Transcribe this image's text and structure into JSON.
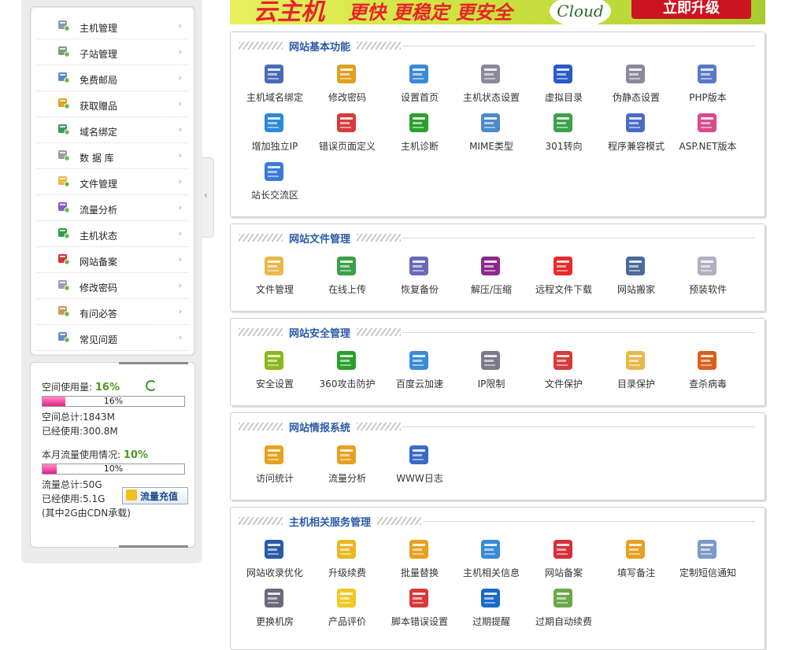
{
  "sidebar": {
    "items": [
      {
        "label": "主机管理",
        "icon": "server-icon",
        "color": "#8a9aa8"
      },
      {
        "label": "子站管理",
        "icon": "subsite-icon",
        "color": "#7aa07a"
      },
      {
        "label": "免费邮局",
        "icon": "mail-icon",
        "color": "#5a8ac8"
      },
      {
        "label": "获取赠品",
        "icon": "gift-icon",
        "color": "#e0a020"
      },
      {
        "label": "域名绑定",
        "icon": "globe-icon",
        "color": "#3a9a5a"
      },
      {
        "label": "数 据 库",
        "icon": "database-icon",
        "color": "#9a9aa8"
      },
      {
        "label": "文件管理",
        "icon": "folder-icon",
        "color": "#e8b84a"
      },
      {
        "label": "流量分析",
        "icon": "chart-icon",
        "color": "#8a5ac8"
      },
      {
        "label": "主机状态",
        "icon": "status-icon",
        "color": "#2aa04a"
      },
      {
        "label": "网站备案",
        "icon": "record-icon",
        "color": "#d8303a"
      },
      {
        "label": "修改密码",
        "icon": "password-icon",
        "color": "#9aa0b0"
      },
      {
        "label": "有问必答",
        "icon": "qa-icon",
        "color": "#c89a5a"
      },
      {
        "label": "常见问题",
        "icon": "faq-icon",
        "color": "#6a8ac8"
      }
    ]
  },
  "usage": {
    "space_label": "空间使用量:",
    "space_percent": "16%",
    "space_fraction": 0.16,
    "space_total": "空间总计:1843M",
    "space_used": "已经使用:300.8M",
    "traffic_label": "本月流量使用情况:",
    "traffic_percent": "10%",
    "traffic_fraction": 0.1,
    "traffic_total": "流量总计:50G",
    "traffic_used": "已经使用:5.1G",
    "cdn_note": "(其中2G由CDN承载)",
    "recharge_label": "流量充值"
  },
  "banner": {
    "title": "云主机",
    "slogan": "更快 更稳定 更安全",
    "cloud": "Cloud",
    "upgrade": "立即升级"
  },
  "sections": [
    {
      "title": "网站基本功能",
      "tools": [
        {
          "label": "主机域名绑定",
          "icon": "domain-bind-icon",
          "color": "#4a6ab8"
        },
        {
          "label": "修改密码",
          "icon": "lock-icon",
          "color": "#e0a020"
        },
        {
          "label": "设置首页",
          "icon": "homepage-icon",
          "color": "#3a8ad8"
        },
        {
          "label": "主机状态设置",
          "icon": "gear-icon",
          "color": "#8a8a9a"
        },
        {
          "label": "虚拟目录",
          "icon": "clock-icon",
          "color": "#2a5ac8"
        },
        {
          "label": "伪静态设置",
          "icon": "rewrite-icon",
          "color": "#8a8a9a"
        },
        {
          "label": "PHP版本",
          "icon": "php-icon",
          "color": "#5a7ac8"
        },
        {
          "label": "增加独立IP",
          "icon": "ip-icon",
          "color": "#2a8ad8"
        },
        {
          "label": "错误页面定义",
          "icon": "error-page-icon",
          "color": "#d83a3a"
        },
        {
          "label": "主机诊断",
          "icon": "plus-icon",
          "color": "#2aa02a"
        },
        {
          "label": "MIME类型",
          "icon": "mime-icon",
          "color": "#4a8ac8"
        },
        {
          "label": "301转向",
          "icon": "redirect-icon",
          "color": "#3aa04a"
        },
        {
          "label": "程序兼容模式",
          "icon": "compat-icon",
          "color": "#4a6ac8"
        },
        {
          "label": "ASP.NET版本",
          "icon": "aspnet-icon",
          "color": "#d84a8a"
        },
        {
          "label": "站长交流区",
          "icon": "users-icon",
          "color": "#3a7ad8"
        }
      ]
    },
    {
      "title": "网站文件管理",
      "tools": [
        {
          "label": "文件管理",
          "icon": "folder-search-icon",
          "color": "#e8b84a"
        },
        {
          "label": "在线上传",
          "icon": "upload-icon",
          "color": "#3aa04a"
        },
        {
          "label": "恢复备份",
          "icon": "backup-icon",
          "color": "#6a6ab8"
        },
        {
          "label": "解压/压缩",
          "icon": "archive-icon",
          "color": "#8a2a8a"
        },
        {
          "label": "远程文件下载",
          "icon": "download-icon",
          "color": "#e82a2a"
        },
        {
          "label": "网站搬家",
          "icon": "truck-icon",
          "color": "#4a6a9a"
        },
        {
          "label": "预装软件",
          "icon": "cd-icon",
          "color": "#b0b0c0"
        }
      ]
    },
    {
      "title": "网站安全管理",
      "tools": [
        {
          "label": "安全设置",
          "icon": "shield-icon",
          "color": "#8ab81a"
        },
        {
          "label": "360攻击防护",
          "icon": "shield-plus-icon",
          "color": "#2aa02a"
        },
        {
          "label": "百度云加速",
          "icon": "cloud-icon",
          "color": "#3a8ad8"
        },
        {
          "label": "IP限制",
          "icon": "chain-icon",
          "color": "#7a7a8a"
        },
        {
          "label": "文件保护",
          "icon": "file-lock-icon",
          "color": "#d83a3a"
        },
        {
          "label": "目录保护",
          "icon": "folder-lock-icon",
          "color": "#e8b84a"
        },
        {
          "label": "查杀病毒",
          "icon": "bug-icon",
          "color": "#d8601a"
        }
      ]
    },
    {
      "title": "网站情报系统",
      "tools": [
        {
          "label": "访问统计",
          "icon": "stats-icon",
          "color": "#e8a020"
        },
        {
          "label": "流量分析",
          "icon": "traffic-icon",
          "color": "#e8a020"
        },
        {
          "label": "WWW日志",
          "icon": "log-icon",
          "color": "#3a6ac8"
        }
      ]
    },
    {
      "title": "主机相关服务管理",
      "tools": [
        {
          "label": "网站收录优化",
          "icon": "seo-icon",
          "color": "#2a5aa8"
        },
        {
          "label": "升级续费",
          "icon": "coins-icon",
          "color": "#e8b820"
        },
        {
          "label": "批量替换",
          "icon": "replace-icon",
          "color": "#e8a020"
        },
        {
          "label": "主机相关信息",
          "icon": "info-icon",
          "color": "#3a8ad8"
        },
        {
          "label": "网站备案",
          "icon": "record-icon",
          "color": "#d8303a"
        },
        {
          "label": "填写备注",
          "icon": "note-icon",
          "color": "#e8a020"
        },
        {
          "label": "定制短信通知",
          "icon": "sms-icon",
          "color": "#7a9ac8"
        },
        {
          "label": "更换机房",
          "icon": "house-icon",
          "color": "#6a6a7a"
        },
        {
          "label": "产品评价",
          "icon": "smile-icon",
          "color": "#f0c820"
        },
        {
          "label": "脚本错误设置",
          "icon": "script-error-icon",
          "color": "#d83a3a"
        },
        {
          "label": "过期提醒",
          "icon": "check-icon",
          "color": "#1a6ac8"
        },
        {
          "label": "过期自动续费",
          "icon": "auto-renew-icon",
          "color": "#6aa84a"
        }
      ]
    }
  ]
}
